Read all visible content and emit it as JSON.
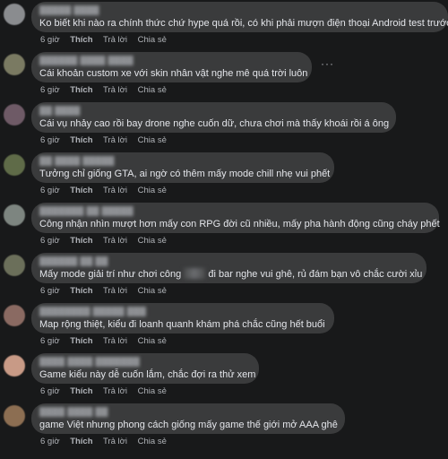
{
  "colors": {
    "background": "#18191a",
    "bubble": "#3a3b3c",
    "text": "#e4e6eb",
    "meta": "#b0b3b8"
  },
  "comments": [
    {
      "text": "Ko biết khi nào ra chính thức chứ hype quá rồi, có khi phải mượn điện thoại Android test trước",
      "time": "6 giờ",
      "like": "Thích",
      "reply": "Trả lời",
      "share": "Chia sẻ"
    },
    {
      "text": "Cái khoản custom xe với skin nhân vật nghe mê quá trời luôn",
      "time": "6 giờ",
      "like": "Thích",
      "reply": "Trả lời",
      "share": "Chia sẻ"
    },
    {
      "text": "Cái vụ nhảy cao rồi bay drone nghe cuốn dữ, chưa chơi mà thấy khoái rồi á ông",
      "time": "6 giờ",
      "like": "Thích",
      "reply": "Trả lời",
      "share": "Chia sẻ"
    },
    {
      "text": "Tưởng chỉ giống GTA, ai ngờ có thêm mấy mode chill nhẹ vui phết",
      "time": "6 giờ",
      "like": "Thích",
      "reply": "Trả lời",
      "share": "Chia sẻ"
    },
    {
      "text": "Công nhận nhìn mượt hơn mấy con RPG đời cũ nhiều, mấy pha hành động cũng cháy phết",
      "time": "6 giờ",
      "like": "Thích",
      "reply": "Trả lời",
      "share": "Chia sẻ"
    },
    {
      "text_before": "Mấy mode giải trí như chơi công ",
      "text_after": " đi bar nghe vui ghê, rủ đám bạn vô chắc cười xỉu",
      "time": "6 giờ",
      "like": "Thích",
      "reply": "Trả lời",
      "share": "Chia sẻ"
    },
    {
      "text": "Map rộng thiệt, kiểu đi loanh quanh khám phá chắc cũng hết buổi",
      "time": "6 giờ",
      "like": "Thích",
      "reply": "Trả lời",
      "share": "Chia sẻ"
    },
    {
      "text": "Game kiểu này dễ cuốn lắm, chắc đợi ra thử xem",
      "time": "6 giờ",
      "like": "Thích",
      "reply": "Trả lời",
      "share": "Chia sẻ"
    },
    {
      "text": "game Việt nhưng phong cách giống mấy game thế giới mở AAA ghê",
      "time": "6 giờ",
      "like": "Thích",
      "reply": "Trả lời",
      "share": "Chia sẻ"
    }
  ]
}
